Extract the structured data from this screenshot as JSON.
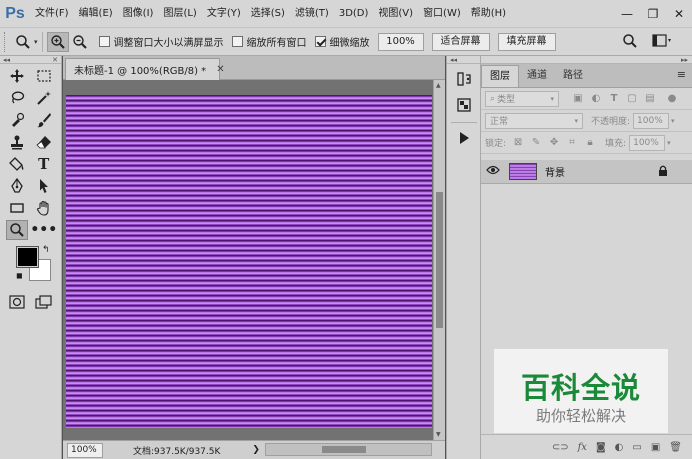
{
  "app": {
    "logo": "Ps"
  },
  "menu": [
    "文件(F)",
    "编辑(E)",
    "图像(I)",
    "图层(L)",
    "文字(Y)",
    "选择(S)",
    "滤镜(T)",
    "3D(D)",
    "视图(V)",
    "窗口(W)",
    "帮助(H)"
  ],
  "window_controls": {
    "minimize": "—",
    "restore": "❐",
    "close": "✕"
  },
  "options": {
    "tool_icon": "zoom-icon",
    "resize_windows_label": "调整窗口大小以满屏显示",
    "resize_windows_checked": false,
    "zoom_all_label": "缩放所有窗口",
    "zoom_all_checked": false,
    "scrubby_zoom_label": "细微缩放",
    "scrubby_zoom_checked": true,
    "zoom_value": "100%",
    "fit_screen_label": "适合屏幕",
    "fill_screen_label": "填充屏幕"
  },
  "toolbar": {
    "tools": [
      [
        "move-icon",
        "marquee-icon"
      ],
      [
        "lasso-icon",
        "magic-wand-icon"
      ],
      [
        "eyedropper-icon",
        "brush-icon"
      ],
      [
        "stamp-icon",
        "eraser-icon"
      ],
      [
        "bucket-icon",
        "type-icon"
      ],
      [
        "pen-icon",
        "path-select-icon"
      ],
      [
        "rectangle-icon",
        "hand-icon"
      ],
      [
        "zoom-icon",
        "more-icon"
      ]
    ],
    "foreground_color": "#000000",
    "background_color": "#ffffff"
  },
  "document": {
    "tab_title": "未标题-1 @ 100%(RGB/8) *",
    "status_zoom": "100%",
    "status_doc": "文档:937.5K/937.5K",
    "stripe_colors": [
      "#3e0f55",
      "#9a50cf",
      "#d8a3ff"
    ]
  },
  "panels": {
    "tabs": [
      "图层",
      "通道",
      "路径"
    ],
    "active_tab": "图层",
    "filter_kind": "类型",
    "blend_mode": "正常",
    "opacity_label": "不透明度:",
    "opacity_value": "100%",
    "lock_label": "锁定:",
    "fill_label": "填充:",
    "fill_value": "100%",
    "layers": [
      {
        "name": "背景",
        "visible": true,
        "locked": true
      }
    ]
  },
  "watermark": {
    "title": "百科全说",
    "subtitle": "助你轻松解决",
    "color": "#1a8a39"
  }
}
